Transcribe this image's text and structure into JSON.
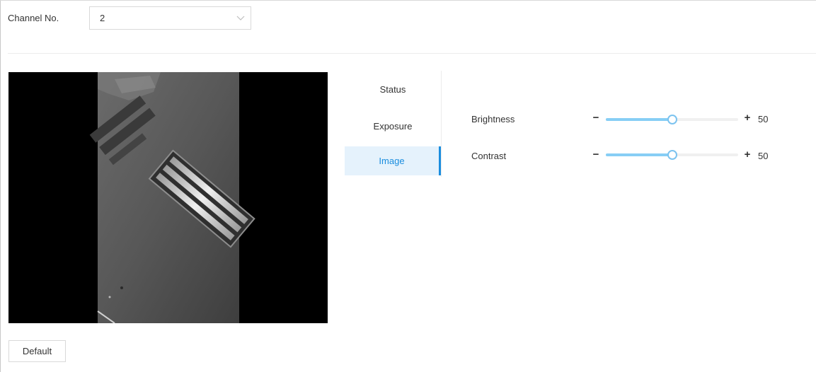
{
  "channel": {
    "label": "Channel No.",
    "selected": "2"
  },
  "preview": {
    "description_icon": "camera-preview"
  },
  "tabs": [
    {
      "label": "Status",
      "active": false
    },
    {
      "label": "Exposure",
      "active": false
    },
    {
      "label": "Image",
      "active": true
    }
  ],
  "settings": {
    "brightness": {
      "label": "Brightness",
      "value": 50,
      "min": 0,
      "max": 100,
      "display": "50"
    },
    "contrast": {
      "label": "Contrast",
      "value": 50,
      "min": 0,
      "max": 100,
      "display": "50"
    }
  },
  "controls": {
    "minus_symbol": "−",
    "plus_symbol": "+"
  },
  "footer": {
    "default_label": "Default"
  },
  "colors": {
    "accent": "#1a8dde",
    "active_tab_bg": "#e5f2fc",
    "slider_fill": "#87cef5"
  },
  "icons": {
    "select_arrow": "chevron-down-icon"
  }
}
